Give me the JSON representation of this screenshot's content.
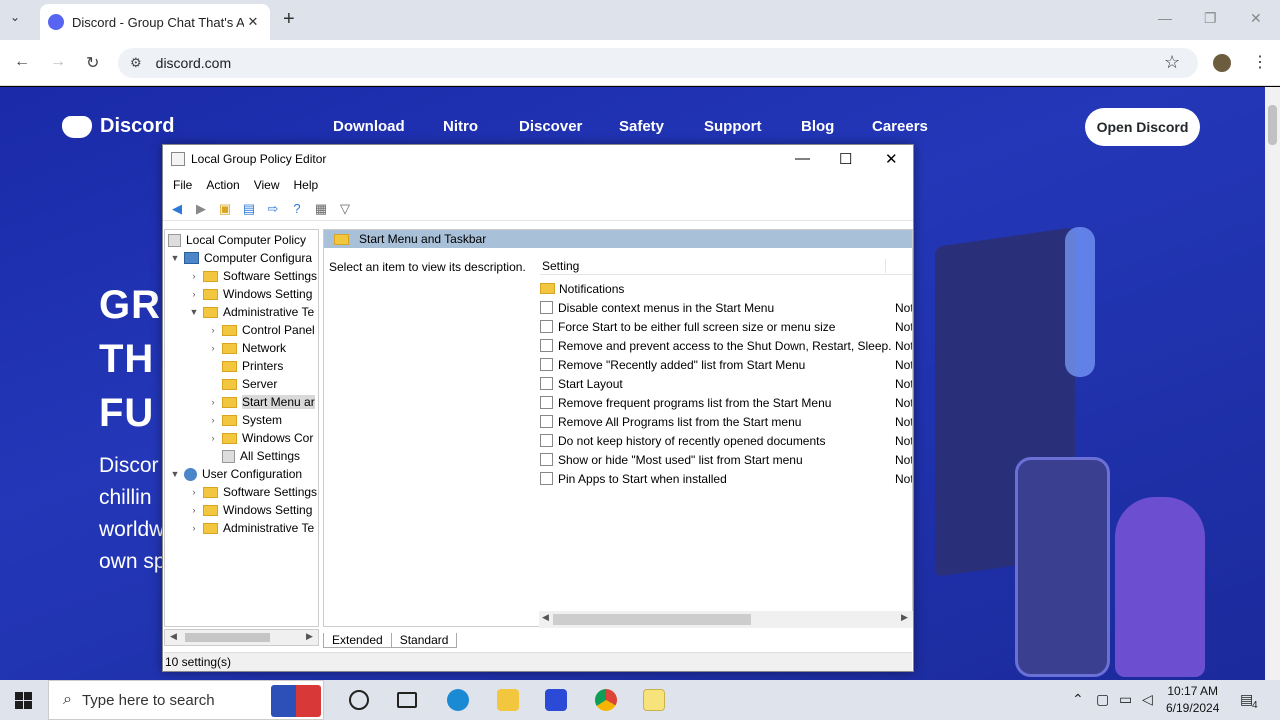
{
  "browser": {
    "tab_title": "Discord - Group Chat That's All",
    "url": "discord.com",
    "new_tab": "+",
    "tab_close": "✕",
    "menu_chevron": "⌄",
    "win_minimize": "—",
    "win_restore": "❐",
    "win_close": "✕",
    "back": "←",
    "forward": "→",
    "reload": "↻",
    "star": "☆",
    "kebab": "⋮"
  },
  "discord": {
    "logo_text": "Discord",
    "nav": [
      "Download",
      "Nitro",
      "Discover",
      "Safety",
      "Support",
      "Blog",
      "Careers"
    ],
    "open_button": "Open Discord",
    "hero_lines": [
      "GR",
      "TH",
      "FU"
    ],
    "sub_lines": [
      "Discor",
      "chillin",
      "worldw",
      "own sp"
    ]
  },
  "gpedit": {
    "title": "Local Group Policy Editor",
    "menu": [
      "File",
      "Action",
      "View",
      "Help"
    ],
    "tree": {
      "root": "Local Computer Policy",
      "computer_config": "Computer Configura",
      "cc_software": "Software Settings",
      "cc_windows": "Windows Setting",
      "cc_admin": "Administrative Te",
      "control_panel": "Control Panel",
      "network": "Network",
      "printers": "Printers",
      "server": "Server",
      "start_menu": "Start Menu ar",
      "system": "System",
      "windows_components": "Windows Cor",
      "all_settings": "All Settings",
      "user_config": "User Configuration",
      "uc_software": "Software Settings",
      "uc_windows": "Windows Setting",
      "uc_admin": "Administrative Te"
    },
    "right_header": "Start Menu and Taskbar",
    "description": "Select an item to view its description.",
    "column_setting": "Setting",
    "rows": [
      {
        "name": "Notifications",
        "state": "",
        "folder": true
      },
      {
        "name": "Disable context menus in the Start Menu",
        "state": "Not"
      },
      {
        "name": "Force Start to be either full screen size or menu size",
        "state": "Not"
      },
      {
        "name": "Remove and prevent access to the Shut Down, Restart, Sleep...",
        "state": "Not"
      },
      {
        "name": "Remove \"Recently added\" list from Start Menu",
        "state": "Not"
      },
      {
        "name": "Start Layout",
        "state": "Not"
      },
      {
        "name": "Remove frequent programs list from the Start Menu",
        "state": "Not"
      },
      {
        "name": "Remove All Programs list from the Start menu",
        "state": "Not"
      },
      {
        "name": "Do not keep history of recently opened documents",
        "state": "Not"
      },
      {
        "name": "Show or hide \"Most used\" list from Start menu",
        "state": "Not"
      },
      {
        "name": "Pin Apps to Start when installed",
        "state": "Not"
      }
    ],
    "tabs": [
      "Extended",
      "Standard"
    ],
    "status": "10 setting(s)"
  },
  "taskbar": {
    "search_placeholder": "Type here to search",
    "time": "10:17 AM",
    "date": "6/19/2024",
    "notif_count": "4"
  }
}
